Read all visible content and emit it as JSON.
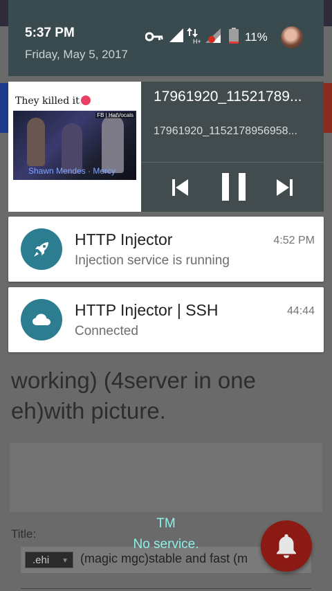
{
  "status_bar": {
    "time": "5:37 PM",
    "date": "Friday, May 5, 2017",
    "battery_percent": "11%",
    "icons": [
      "vpn-key-icon",
      "signal-icon",
      "data-arrows-icon",
      "signal-icon",
      "battery-icon"
    ]
  },
  "media": {
    "title": "17961920_11521789...",
    "subtitle": "17961920_1152178956958...",
    "art_caption": "They killed it",
    "art_overlay": "Shawn Mendes · Mercy",
    "art_tag": "FB | HatVocals",
    "controls": [
      "previous-icon",
      "pause-icon",
      "next-icon"
    ]
  },
  "notifications": [
    {
      "app": "HTTP Injector",
      "text": "Injection service is running",
      "time": "4:52 PM",
      "icon": "rocket-icon"
    },
    {
      "app": "HTTP Injector | SSH",
      "text": "Connected",
      "time": "44:44",
      "icon": "cloud-icon"
    }
  ],
  "background": {
    "thread_title_visible": "working) (4server in one eh)with picture.",
    "title_label": "Title:",
    "prefix": ".ehi",
    "title_value": "(magic mgc)stable and fast (m"
  },
  "carrier": {
    "name": "TM",
    "status": "No service."
  },
  "colors": {
    "shade_header": "#3a4b50",
    "media_card": "#424b4e",
    "notif_icon": "#2c7d90",
    "carrier_text": "#8ff0e8",
    "fab": "#8c1a14"
  }
}
